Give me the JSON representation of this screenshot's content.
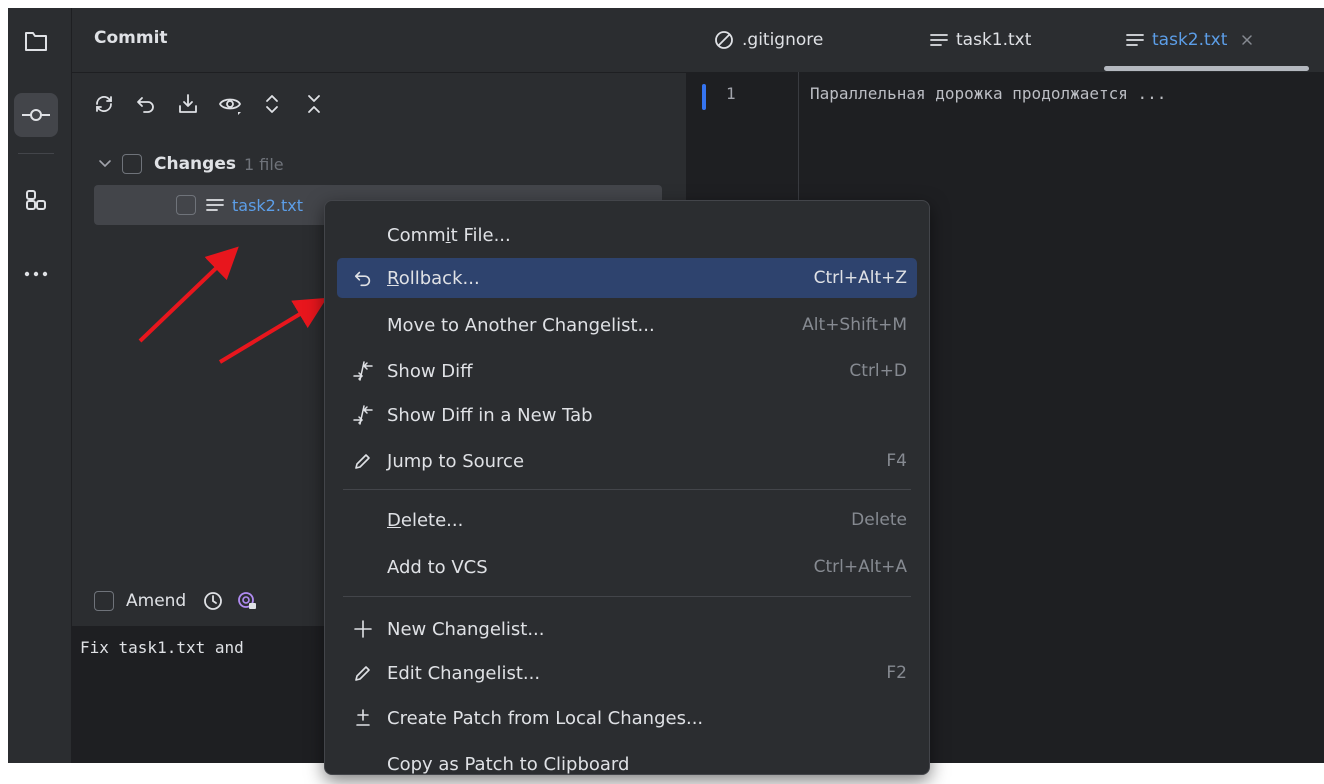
{
  "panel": {
    "title": "Commit",
    "changes_label": "Changes",
    "changes_count": "1 file",
    "file_name": "task2.txt",
    "amend_label": "Amend",
    "commit_message": "Fix task1.txt and"
  },
  "tabs": [
    {
      "label": ".gitignore",
      "icon": "ignore-icon"
    },
    {
      "label": "task1.txt",
      "icon": "text-file-icon"
    },
    {
      "label": "task2.txt",
      "icon": "text-file-icon",
      "active": true
    }
  ],
  "editor": {
    "line_number": "1",
    "line_text": "Параллельная дорожка продолжается ..."
  },
  "menu": {
    "items": [
      {
        "pre": "Comm",
        "mn": "i",
        "post": "t File...",
        "shortcut": ""
      },
      {
        "pre": "",
        "mn": "R",
        "post": "ollback...",
        "shortcut": "Ctrl+Alt+Z",
        "icon": "rollback-icon"
      },
      {
        "pre": "Move to Another Changelist...",
        "mn": "",
        "post": "",
        "shortcut": "Alt+Shift+M"
      },
      {
        "pre": "Show Diff",
        "mn": "",
        "post": "",
        "shortcut": "Ctrl+D",
        "icon": "diff-icon"
      },
      {
        "pre": "Show Diff in a New Tab",
        "mn": "",
        "post": "",
        "shortcut": "",
        "icon": "diff-icon"
      },
      {
        "pre": "",
        "mn": "J",
        "post": "ump to Source",
        "shortcut": "F4",
        "icon": "edit-icon"
      },
      {
        "pre": "",
        "mn": "D",
        "post": "elete...",
        "shortcut": "Delete"
      },
      {
        "pre": "Add to VCS",
        "mn": "",
        "post": "",
        "shortcut": "Ctrl+Alt+A"
      },
      {
        "pre": "New Changelist...",
        "mn": "",
        "post": "",
        "shortcut": "",
        "icon": "plus-icon"
      },
      {
        "pre": "Edit Changelist...",
        "mn": "",
        "post": "",
        "shortcut": "F2",
        "icon": "edit-icon"
      },
      {
        "pre": "Create Patch from Local Changes...",
        "mn": "",
        "post": "",
        "shortcut": "",
        "icon": "patch-icon"
      },
      {
        "pre": "Copy as Patch to Clipboard",
        "mn": "",
        "post": "",
        "shortcut": ""
      }
    ]
  },
  "colors": {
    "accent": "#3574f0",
    "selection": "#2e436e",
    "link": "#5c9ee8",
    "arrow": "#e8161d"
  }
}
